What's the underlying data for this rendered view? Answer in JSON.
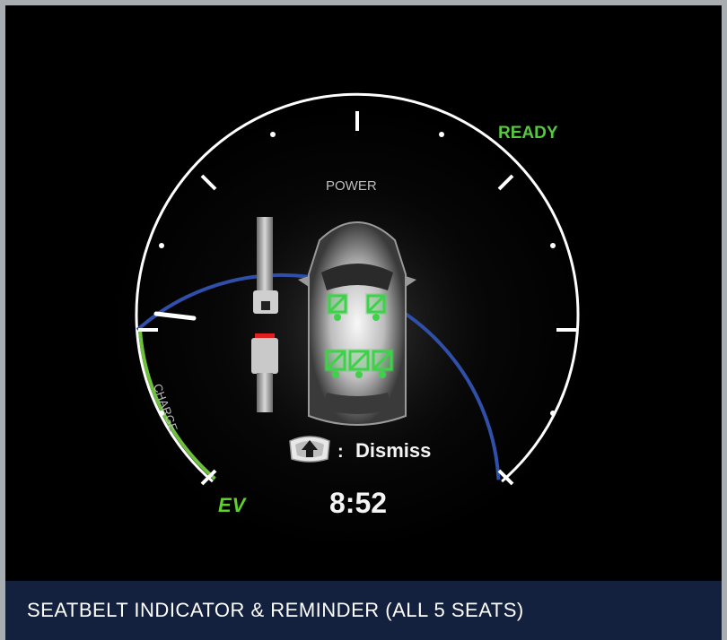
{
  "status": {
    "ready_label": "READY"
  },
  "gauge": {
    "title": "POWER",
    "charge_label": "CHARGE",
    "ev_label": "EV",
    "accent_colors": {
      "power_arc": "#2f4fa8",
      "charge_arc": "#6cc03a",
      "ready": "#57c83e"
    }
  },
  "seatbelt": {
    "seats_total": 5,
    "seats_fastened": 5,
    "indicator_color": "#3fd14a"
  },
  "dismiss": {
    "separator": ":",
    "label": "Dismiss",
    "icon": "steering-button-icon"
  },
  "clock": {
    "time": "8:52"
  },
  "caption": {
    "text": "SEATBELT INDICATOR & REMINDER (ALL 5 SEATS)"
  }
}
